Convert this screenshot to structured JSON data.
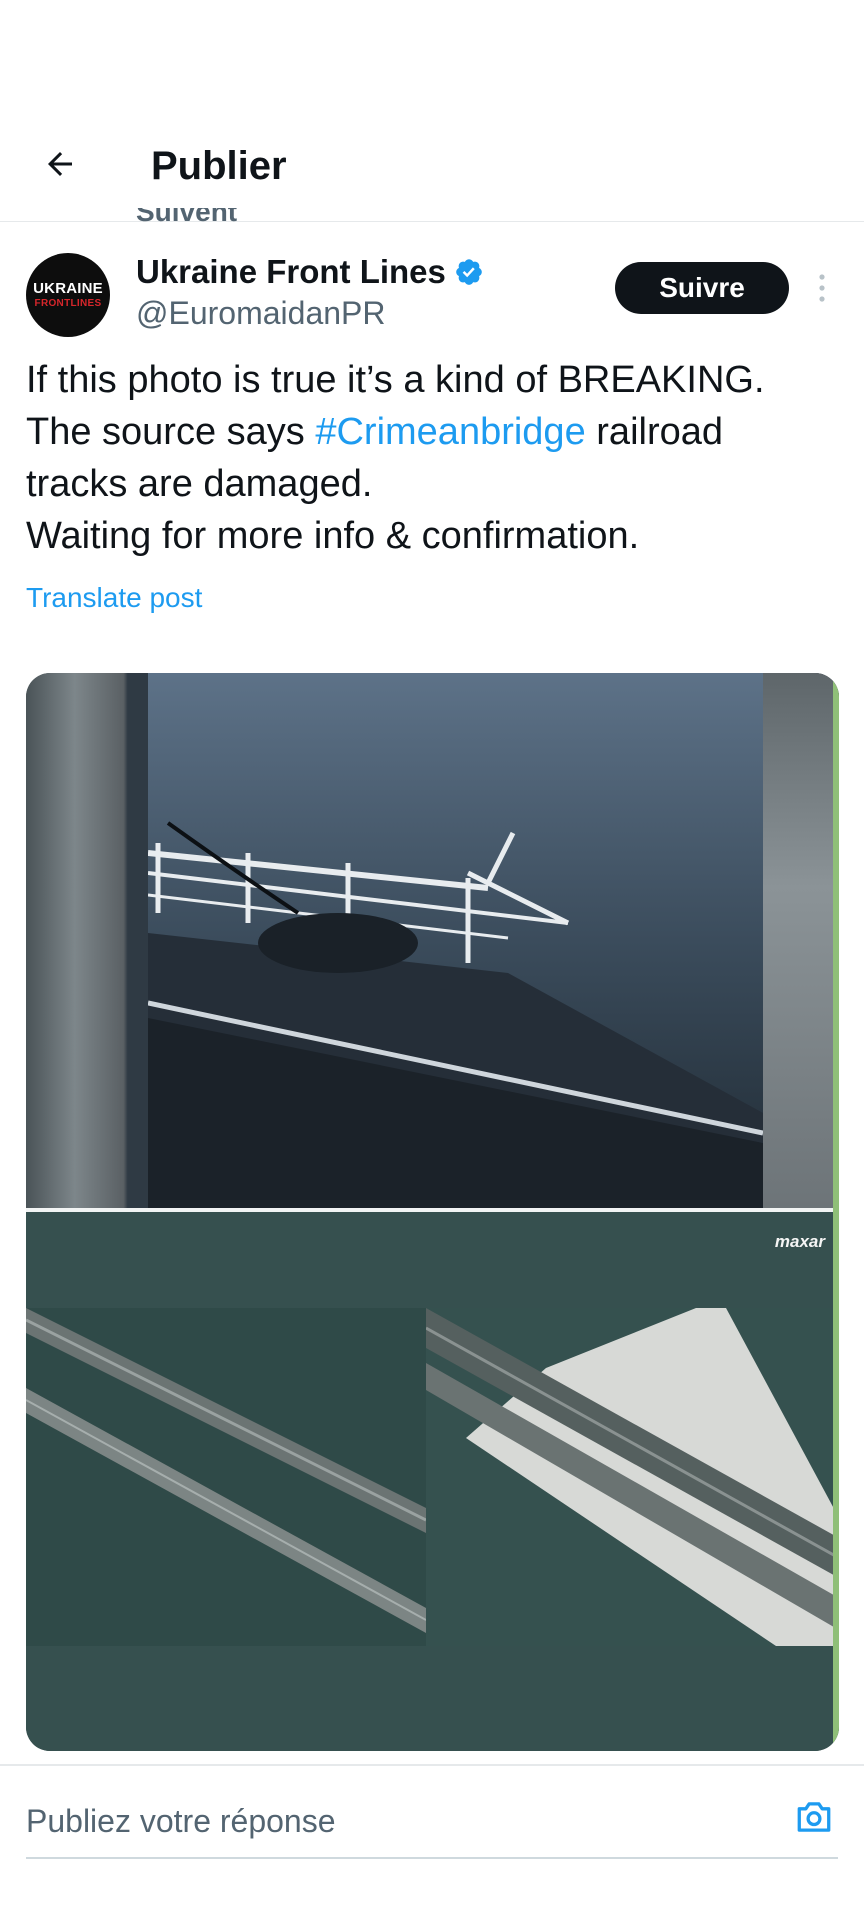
{
  "header": {
    "back_icon": "arrow-left-icon",
    "title": "Publier"
  },
  "clipped_previous_text": "Suivent",
  "tweet": {
    "avatar": {
      "line1": "UKRAINE",
      "line2": "FRONTLINES"
    },
    "display_name": "Ukraine Front Lines",
    "verified_icon": "verified-badge-icon",
    "handle": "@EuromaidanPR",
    "follow_label": "Suivre",
    "more_icon": "more-vertical-icon",
    "text": {
      "line1": "If this photo is true it’s a kind of BREAKING.",
      "line2_before": "The source says ",
      "line2_hashtag": "#Crimeanbridge",
      "line2_after": " railroad",
      "line3": "tracks are damaged.",
      "line4": "Waiting for more info & confirmation."
    },
    "translate_label": "Translate post",
    "media": {
      "watermark": "maxar"
    }
  },
  "reply": {
    "placeholder": "Publiez votre réponse",
    "camera_icon": "camera-icon"
  },
  "colors": {
    "accent": "#1d9bf0",
    "text_primary": "#0f1419",
    "text_secondary": "#536471",
    "follow_bg": "#0f1419"
  }
}
